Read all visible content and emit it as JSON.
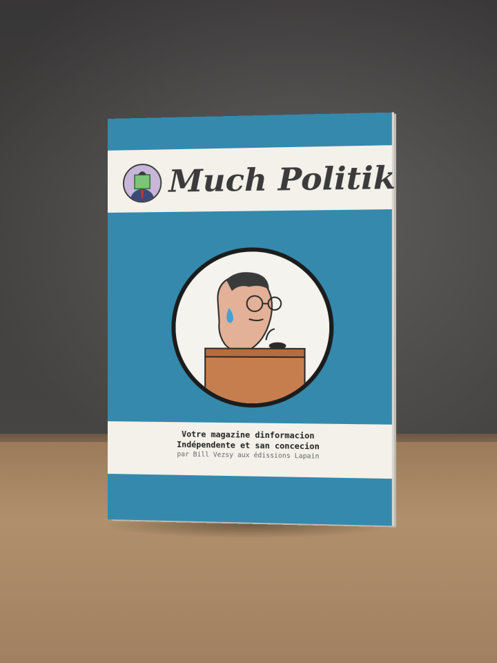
{
  "cover": {
    "title": "Much Politik",
    "tagline_line1": "Votre magazine dinformacion",
    "tagline_line2": "Indépendente et san concecion",
    "credit": "par Bill Vezsy aux édissions Lapain"
  },
  "icons": {
    "logo": "reading-man-logo-icon",
    "illustration": "speaker-at-podium-icon"
  },
  "colors": {
    "cover_blue": "#3589ac",
    "band": "#f3f1ea",
    "wall": "#565453",
    "table": "#a8875f"
  }
}
